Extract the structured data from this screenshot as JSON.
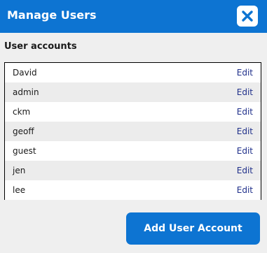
{
  "header": {
    "title": "Manage Users",
    "close_icon": "close-icon",
    "color": "#0d74d2"
  },
  "section": {
    "label": "User accounts"
  },
  "users": [
    {
      "name": "David",
      "action": "Edit"
    },
    {
      "name": "admin",
      "action": "Edit"
    },
    {
      "name": "ckm",
      "action": "Edit"
    },
    {
      "name": "geoff",
      "action": "Edit"
    },
    {
      "name": "guest",
      "action": "Edit"
    },
    {
      "name": "jen",
      "action": "Edit"
    },
    {
      "name": "lee",
      "action": "Edit"
    }
  ],
  "footer": {
    "add_label": "Add User Account"
  }
}
